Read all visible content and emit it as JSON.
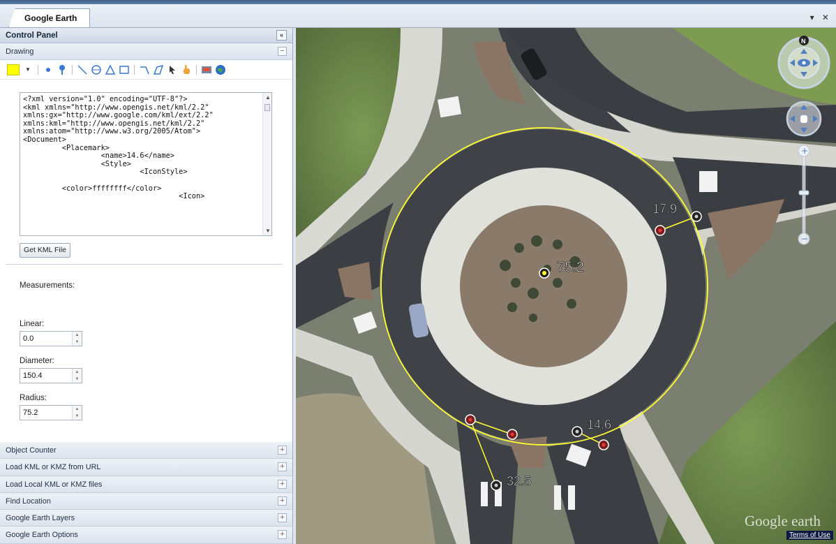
{
  "window": {
    "tab_title": "Google Earth",
    "tab_controls": "▾ ✕"
  },
  "panel": {
    "title": "Control Panel",
    "collapse_icon": "«",
    "drawing": {
      "title": "Drawing",
      "state": "−",
      "fill_color": "#ffff00"
    },
    "kml_lines": [
      "<?xml version=\"1.0\" encoding=\"UTF-8\"?>",
      "<kml xmlns=\"http://www.opengis.net/kml/2.2\"",
      "xmlns:gx=\"http://www.google.com/kml/ext/2.2\"",
      "xmlns:kml=\"http://www.opengis.net/kml/2.2\"",
      "xmlns:atom=\"http://www.w3.org/2005/Atom\">",
      "<Document>",
      "         <Placemark>",
      "                  <name>14.6</name>",
      "                  <Style>",
      "                           <IconStyle>",
      "",
      "         <color>ffffffff</color>",
      "                                    <Icon>"
    ],
    "get_kml_button": "Get KML File",
    "measurements_label": "Measurements:",
    "linear": {
      "label": "Linear:",
      "value": "0.0"
    },
    "diameter": {
      "label": "Diameter:",
      "value": "150.4"
    },
    "radius": {
      "label": "Radius:",
      "value": "75.2"
    },
    "sections": [
      "Object Counter",
      "Load KML or KMZ from URL",
      "Load Local KML or KMZ files",
      "Find Location",
      "Google Earth Layers",
      "Google Earth Options"
    ],
    "section_state": "+"
  },
  "map": {
    "markers": [
      {
        "label": "75.2"
      },
      {
        "label": "17.9"
      },
      {
        "label": "14.6"
      },
      {
        "label": "32.5"
      }
    ],
    "compass_n": "N",
    "watermark": "Google earth",
    "terms": "Terms of Use",
    "circle_color": "#ffff33"
  }
}
